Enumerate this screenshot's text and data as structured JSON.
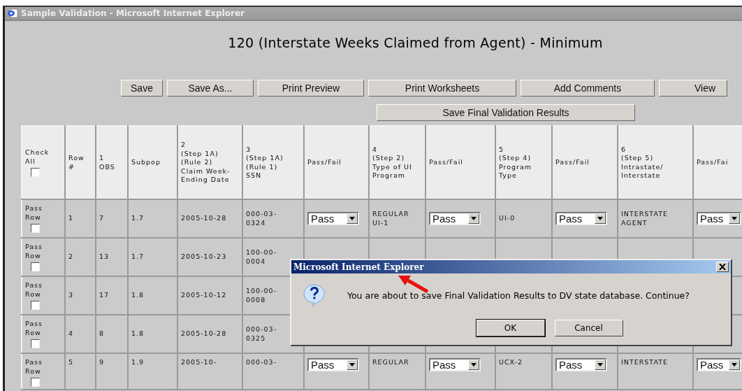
{
  "window": {
    "title": "Sample Validation - Microsoft Internet Explorer"
  },
  "heading": "120 (Interstate Weeks Claimed from Agent) - Minimum",
  "toolbar": [
    {
      "label": "Save"
    },
    {
      "label": "Save As..."
    },
    {
      "label": "Print Preview"
    },
    {
      "label": "Print Worksheets"
    },
    {
      "label": "Add Comments"
    },
    {
      "label": "View"
    }
  ],
  "final_button": {
    "label": "Save Final Validation Results"
  },
  "table": {
    "check_all": {
      "label": "Check All",
      "checked": false
    },
    "columns": [
      "Row #",
      "1\nOBS",
      "Subpop",
      "2\n(Step 1A)\n(Rule 2)\nClaim Week-Ending Date",
      "3\n(Step 1A)\n(Rule 1)\nSSN",
      "Pass/Fail",
      "4\n(Step 2)\nType of UI Program",
      "Pass/Fail",
      "5\n(Step 4)\nProgram Type",
      "Pass/Fail",
      "6\n(Step 5)\nIntrastate/\nInterstate",
      "Pass/Fai"
    ],
    "rows": [
      {
        "pass_row": {
          "label": "Pass Row",
          "checked": false
        },
        "cells": [
          "1",
          "7",
          "1.7",
          "2005-10-28",
          "000-03-0324",
          {
            "select": "Pass"
          },
          "REGULAR UI-1",
          {
            "select": "Pass"
          },
          "UI-0",
          {
            "select": "Pass"
          },
          "INTERSTATE AGENT",
          {
            "select": "Pass"
          }
        ]
      },
      {
        "pass_row": {
          "label": "Pass Row",
          "checked": false
        },
        "cells": [
          "2",
          "13",
          "1.7",
          "2005-10-23",
          "100-00-0004",
          null,
          null,
          null,
          null,
          null,
          null,
          null
        ]
      },
      {
        "pass_row": {
          "label": "Pass Row",
          "checked": false
        },
        "cells": [
          "3",
          "17",
          "1.8",
          "2005-10-12",
          "100-00-0008",
          null,
          null,
          null,
          null,
          null,
          null,
          null
        ]
      },
      {
        "pass_row": {
          "label": "Pass Row",
          "checked": false
        },
        "cells": [
          "4",
          "8",
          "1.8",
          "2005-10-28",
          "000-03-0325",
          null,
          null,
          null,
          null,
          null,
          null,
          null
        ]
      },
      {
        "pass_row": {
          "label": "Pass Row",
          "checked": false
        },
        "cells": [
          "5",
          "9",
          "1.9",
          "2005-10-",
          "000-03-",
          {
            "select": "Pass"
          },
          "REGULAR",
          {
            "select": "Pass"
          },
          "UCX-2",
          {
            "select": "Pass"
          },
          "INTERSTATE",
          {
            "select": "Pass"
          }
        ]
      }
    ]
  },
  "dialog": {
    "title": "Microsoft Internet Explorer",
    "message": "You are about to save Final Validation Results to DV state database. Continue?",
    "buttons": [
      {
        "label": "OK",
        "default": true
      },
      {
        "label": "Cancel",
        "default": false
      }
    ]
  }
}
